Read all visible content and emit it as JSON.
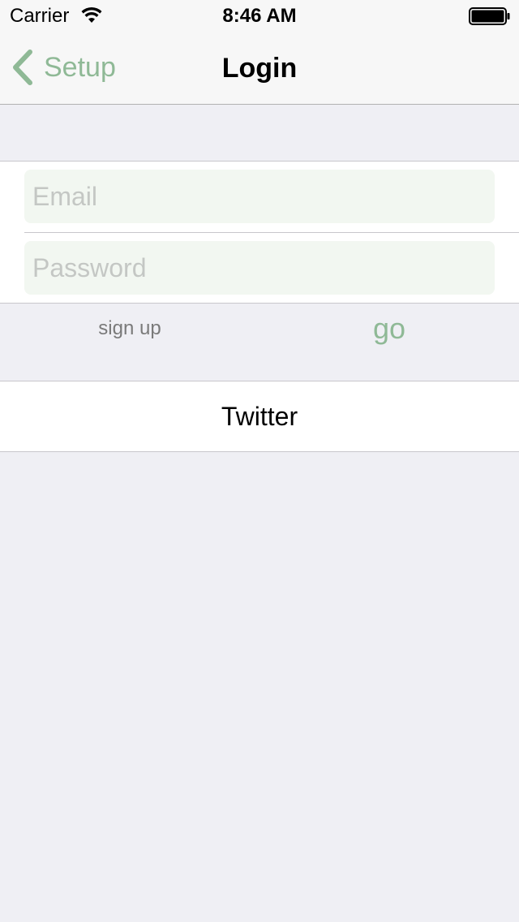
{
  "status_bar": {
    "carrier": "Carrier",
    "time": "8:46 AM",
    "wifi_icon": "wifi-icon",
    "battery_icon": "battery-full-icon"
  },
  "nav_bar": {
    "back_label": "Setup",
    "back_icon": "chevron-left-icon",
    "title": "Login"
  },
  "form": {
    "email_placeholder": "Email",
    "email_value": "",
    "password_placeholder": "Password",
    "password_value": ""
  },
  "actions": {
    "signup_label": "sign up",
    "go_label": "go"
  },
  "social": {
    "twitter_label": "Twitter"
  },
  "colors": {
    "accent": "#8fb996",
    "field_background": "#f2f7f1",
    "page_background": "#efeff4"
  }
}
